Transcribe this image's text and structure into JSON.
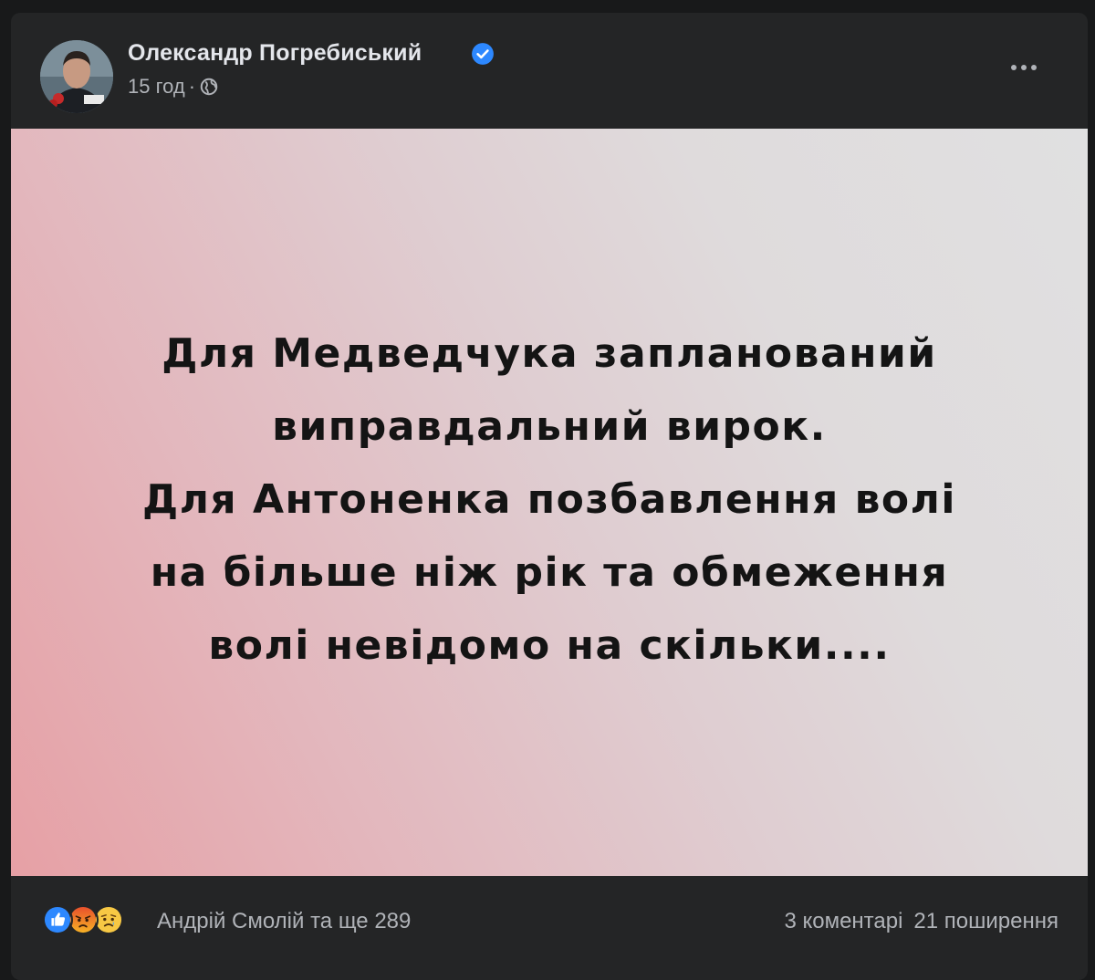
{
  "post": {
    "author": "Олександр Погребиський",
    "verified": true,
    "time": "15 год",
    "separator": "·",
    "privacy_icon": "globe-icon",
    "more_icon": "more-options-icon"
  },
  "image": {
    "lines": [
      "Для Медведчука запланований",
      "виправдальний вирок.",
      "Для Антоненка позбавлення волі",
      "на більше ніж рік та обмеження",
      "волі невідомо на скільки...."
    ],
    "background_colors": [
      "#e6a0a5",
      "#e0e0e1"
    ]
  },
  "footer": {
    "reaction_icons": [
      "like-icon",
      "angry-icon",
      "sad-icon"
    ],
    "reactions_text": "Андрій Смолій та ще 289",
    "comments": "3 коментарі",
    "shares": "21 поширення"
  },
  "colors": {
    "card_bg": "#242526",
    "page_bg": "#18191a",
    "primary_text": "#e4e6eb",
    "secondary_text": "#b0b3b8",
    "verified_blue": "#2d88ff"
  }
}
